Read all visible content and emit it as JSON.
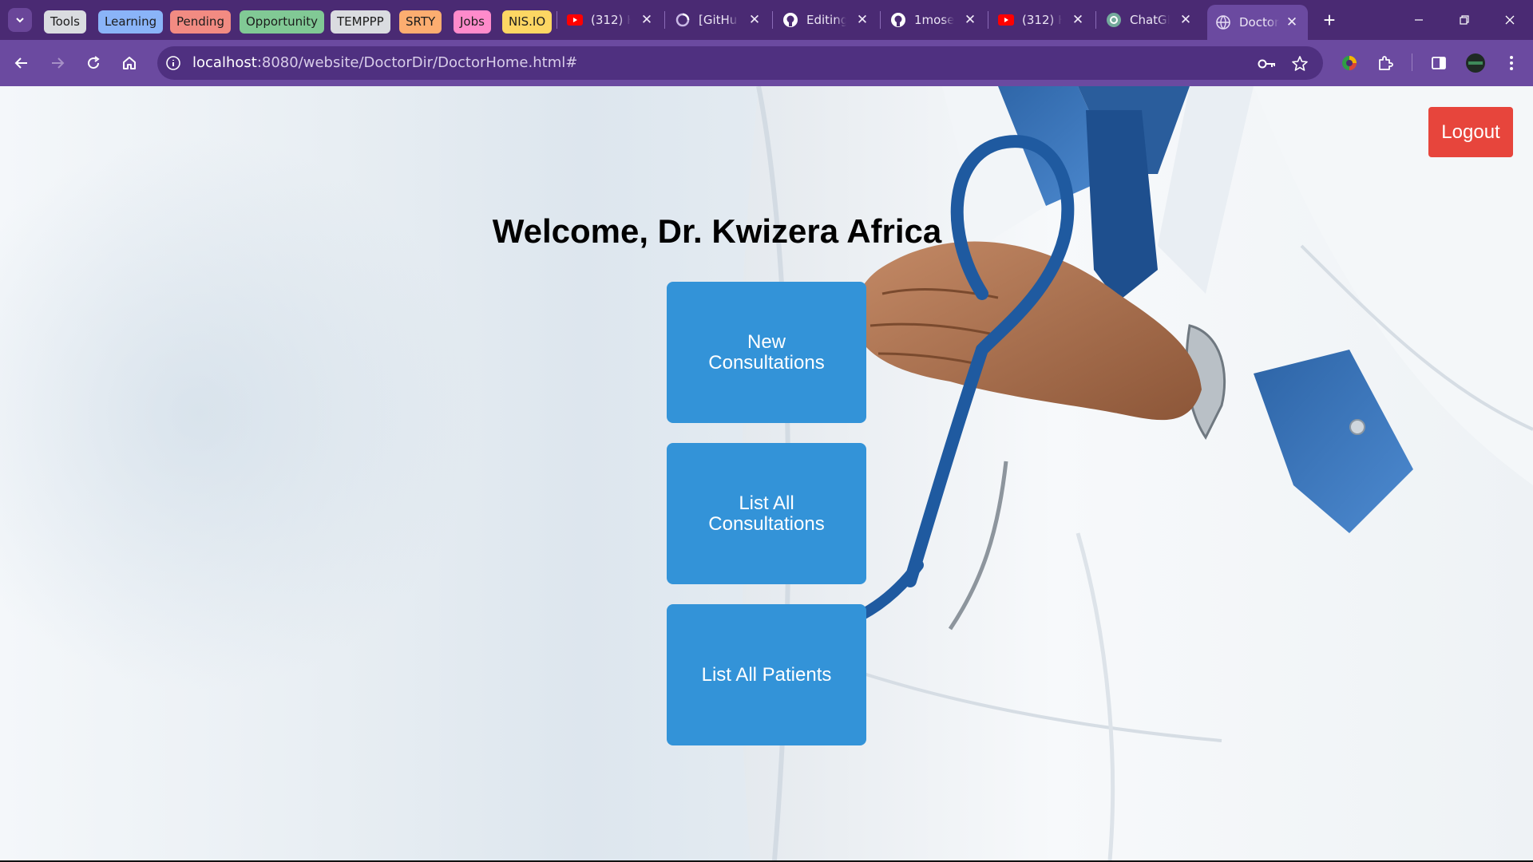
{
  "browser": {
    "tab_groups": [
      {
        "label": "Tools",
        "color": "#dadce0"
      },
      {
        "label": "Learning",
        "color": "#8ab4f8"
      },
      {
        "label": "Pending",
        "color": "#f28b82"
      },
      {
        "label": "Opportunity",
        "color": "#81c995"
      },
      {
        "label": "TEMPPP",
        "color": "#dadce0"
      },
      {
        "label": "SRTY",
        "color": "#fcad70"
      },
      {
        "label": "Jobs",
        "color": "#ff8bcb"
      },
      {
        "label": "NIS.IO",
        "color": "#fdd663"
      }
    ],
    "tabs": [
      {
        "title": "(312) H",
        "icon": "youtube-icon"
      },
      {
        "title": "[GitHu",
        "icon": "loading-icon"
      },
      {
        "title": "Editing",
        "icon": "github-icon"
      },
      {
        "title": "1mose",
        "icon": "github-icon"
      },
      {
        "title": "(312) H",
        "icon": "youtube-icon"
      },
      {
        "title": "ChatGP",
        "icon": "chatgpt-icon"
      },
      {
        "title": "Doctor",
        "icon": "globe-icon",
        "active": true
      }
    ],
    "url_host": "localhost",
    "url_rest": ":8080/website/DoctorDir/DoctorHome.html#",
    "theme_color": "#6b4aa0"
  },
  "page": {
    "logout_label": "Logout",
    "welcome": "Welcome, Dr. Kwizera Africa",
    "actions": [
      {
        "label": "New Consultations"
      },
      {
        "label": "List All Consultations"
      },
      {
        "label": "List All Patients"
      }
    ],
    "colors": {
      "action": "#3393d8",
      "logout": "#e7453c"
    }
  }
}
